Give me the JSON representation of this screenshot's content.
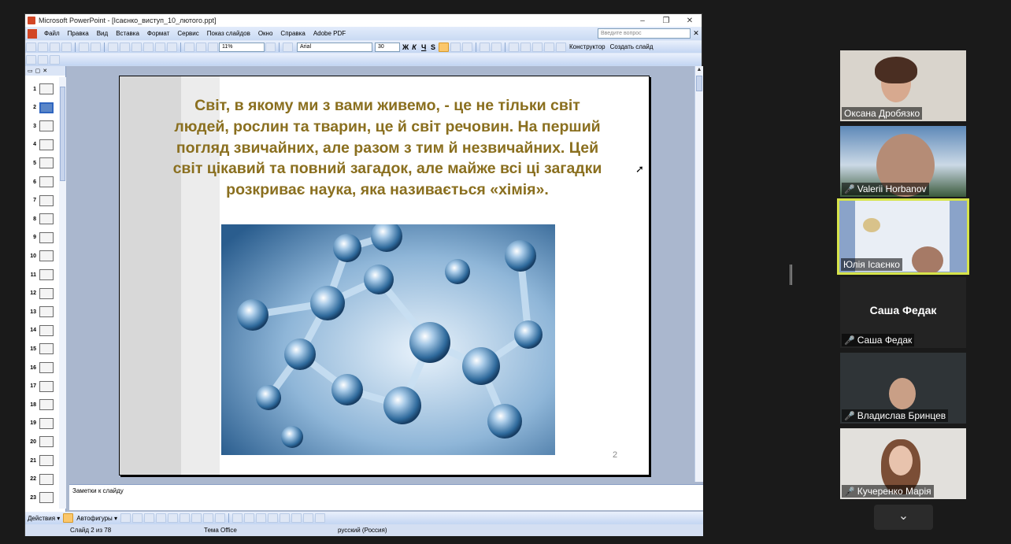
{
  "window": {
    "title": "Microsoft PowerPoint - [Ісаєнко_виступ_10_лютого.ppt]",
    "minimize": "‒",
    "restore": "❐",
    "close": "✕"
  },
  "menu": {
    "items": [
      "Файл",
      "Правка",
      "Вид",
      "Вставка",
      "Формат",
      "Сервис",
      "Показ слайдов",
      "Окно",
      "Справка",
      "Adobe PDF"
    ],
    "ask_placeholder": "Введите вопрос",
    "close": "✕"
  },
  "toolbar": {
    "zoom": "11%",
    "font": "Arial",
    "size": "30",
    "bold": "Ж",
    "italic": "К",
    "underline": "Ч",
    "shadow": "S",
    "designer": "Конструктор",
    "new_slide": "Создать слайд"
  },
  "thumbnails": {
    "numbers": [
      "1",
      "2",
      "3",
      "4",
      "5",
      "6",
      "7",
      "8",
      "9",
      "10",
      "11",
      "12",
      "13",
      "14",
      "15",
      "16",
      "17",
      "18",
      "19",
      "20",
      "21",
      "22",
      "23"
    ],
    "selected": "2"
  },
  "slide": {
    "text": "Світ, в якому ми з вами живемо, - це не тільки світ людей, рослин та тварин, це й світ речовин. На перший погляд звичайних, але разом з тим й незвичайних. Цей світ цікавий та повний загадок, але майже всі ці загадки розкриває наука, яка називається «хімія».",
    "number": "2",
    "text_color": "#8a6f1f"
  },
  "notes": {
    "placeholder": "Заметки к слайду"
  },
  "drawbar": {
    "actions": "Действия ▾",
    "autoshapes": "Автофигуры ▾"
  },
  "status": {
    "slide": "Слайд 2 из 78",
    "theme": "Тема Office",
    "language": "русский (Россия)"
  },
  "participants": [
    {
      "name": "Оксана Дробязко",
      "muted": false
    },
    {
      "name": "Valerii Horbanov",
      "muted": true
    },
    {
      "name": "Юлія Ісаєнко",
      "muted": false,
      "highlight_color": "#d6e34a"
    },
    {
      "name": "Саша Федак",
      "muted": true,
      "video": false
    },
    {
      "name": "Владислав Бринцев",
      "muted": true
    },
    {
      "name": "Кучеренко Марія",
      "muted": true
    }
  ],
  "more_icon": "chevron-down-icon"
}
